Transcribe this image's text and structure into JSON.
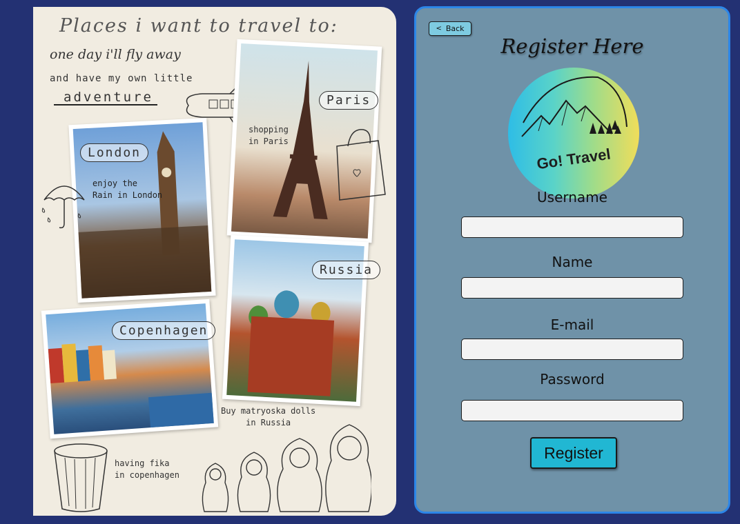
{
  "collage": {
    "title": "Places i want to travel to:",
    "line2": "one day i'll fly away",
    "line3": "and have my own little",
    "line4": "adventure",
    "bubbles": {
      "london": "London",
      "paris": "Paris",
      "russia": "Russia",
      "copenhagen": "Copenhagen"
    },
    "notes": {
      "london": "enjoy the\nRain in London",
      "paris": "shopping\nin Paris",
      "russia": "Buy matryoska dolls\nin Russia",
      "copenhagen": "having fika\nin copenhagen"
    }
  },
  "panel": {
    "back_label": "Back",
    "heading": "Register Here",
    "logo_text": "Go! Travel",
    "fields": [
      {
        "label": "Username",
        "value": ""
      },
      {
        "label": "Name",
        "value": ""
      },
      {
        "label": "E-mail",
        "value": ""
      },
      {
        "label": "Password",
        "value": ""
      }
    ],
    "register_label": "Register"
  },
  "colors": {
    "background": "#233173",
    "panel": "#6f92a8",
    "panel_border": "#2c86e8",
    "button": "#21b7d3"
  },
  "icons": [
    "chevron-left-icon",
    "mountain-icon",
    "airplane-icon",
    "umbrella-icon",
    "shopping-bag-icon",
    "cup-icon",
    "matryoshka-icon"
  ]
}
